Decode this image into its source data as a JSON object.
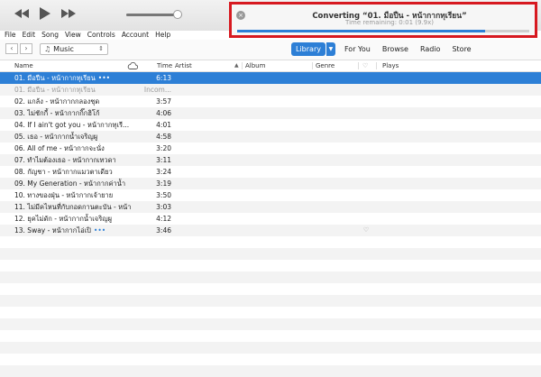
{
  "transport": {
    "prev_icon": "rewind-icon",
    "play_icon": "play-icon",
    "next_icon": "fast-forward-icon",
    "volume_level": 0.92
  },
  "status": {
    "title": "Converting “01. มือปืน - หน้ากากทุเรียน”",
    "remaining": "Time remaining: 0:01 (9.9x)",
    "progress": 0.85,
    "close_icon": "close-icon"
  },
  "menu": [
    "File",
    "Edit",
    "Song",
    "View",
    "Controls",
    "Account",
    "Help"
  ],
  "nav": {
    "back": "‹",
    "forward": "›",
    "media_type": "Music",
    "tabs": [
      "Library",
      "For You",
      "Browse",
      "Radio",
      "Store"
    ]
  },
  "columns": {
    "name": "Name",
    "time": "Time",
    "artist": "Artist",
    "album": "Album",
    "genre": "Genre",
    "plays": "Plays"
  },
  "songs": [
    {
      "name": "01. มือปืน - หน้ากากทุเรียน",
      "time": "6:13",
      "dots": "•••"
    },
    {
      "name": "01. มือปืน - หน้ากากทุเรียน",
      "time": "Incom..."
    },
    {
      "name": "02. แกล้ง - หน้ากากกลองชุด",
      "time": "3:57"
    },
    {
      "name": "03. ไม่ชักกี้ - หน้ากากกิ๊กฮิโก้",
      "time": "4:06"
    },
    {
      "name": "04. If I ain't got you - หน้ากากทุเรี...",
      "time": "4:01"
    },
    {
      "name": "05. เธอ - หน้ากากน้ำเจริญผู",
      "time": "4:58"
    },
    {
      "name": "06. All of me - หน้ากากจะนั่ง",
      "time": "3:20"
    },
    {
      "name": "07. ทำไมต้องเธอ - หน้ากากเทวดา",
      "time": "3:11"
    },
    {
      "name": "08. กัญชา - หน้ากากแมวตาเดียว",
      "time": "3:24"
    },
    {
      "name": "09. My Generation - หน้ากากค่าน้ำ",
      "time": "3:19"
    },
    {
      "name": "10. ทางของฝุ่น - หน้ากากเจ้ายาย",
      "time": "3:50"
    },
    {
      "name": "11. ไม่มีคไหนที่กับกอดกานตะบัน - หน้า...",
      "time": "3:03"
    },
    {
      "name": "12. ยุคไม่ดัก - หน้ากากน้ำเจริญผู",
      "time": "4:12"
    },
    {
      "name": "13. Sway - หน้ากากไอ่เปิ",
      "time": "3:46",
      "dots": "•••",
      "heart": "♡"
    }
  ]
}
